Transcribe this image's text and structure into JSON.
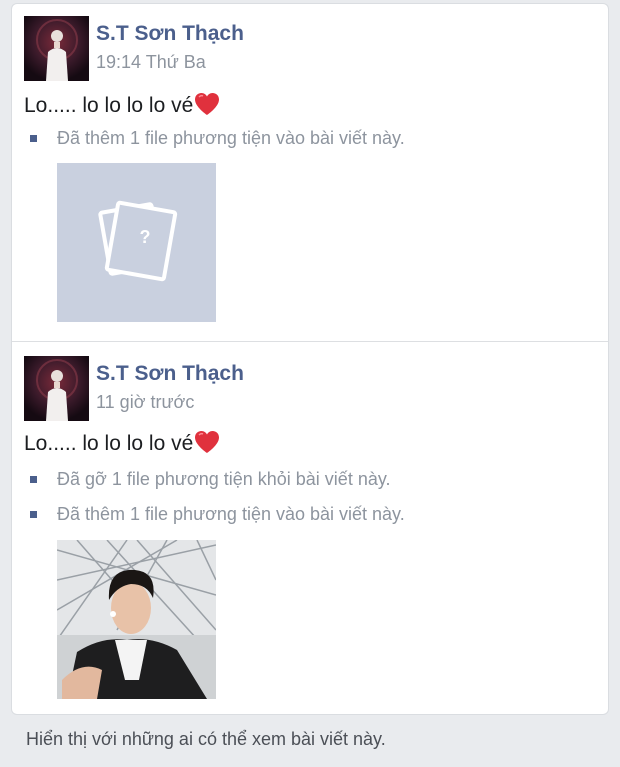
{
  "posts": [
    {
      "author": "S.T Sơn Thạch",
      "time": "19:14 Thứ Ba",
      "message": "Lo..... lo lo lo lo vé",
      "notes": [
        "Đã thêm 1 file phương tiện vào bài viết này."
      ]
    },
    {
      "author": "S.T Sơn Thạch",
      "time": "11 giờ trước",
      "message": "Lo..... lo lo lo lo vé",
      "notes": [
        "Đã gỡ 1 file phương tiện khỏi bài viết này.",
        "Đã thêm 1 file phương tiện vào bài viết này."
      ]
    }
  ],
  "footer": "Hiển thị với những ai có thể xem bài viết này.",
  "colors": {
    "author_blue": "#4b5f8c",
    "meta_gray": "#8d949e",
    "placeholder_bg": "#c9d0df",
    "heart_red": "#e0313d"
  },
  "icons": {
    "heart": "heart-emoji-icon",
    "missing_media": "missing-photo-icon",
    "bullet": "square-bullet-icon"
  }
}
